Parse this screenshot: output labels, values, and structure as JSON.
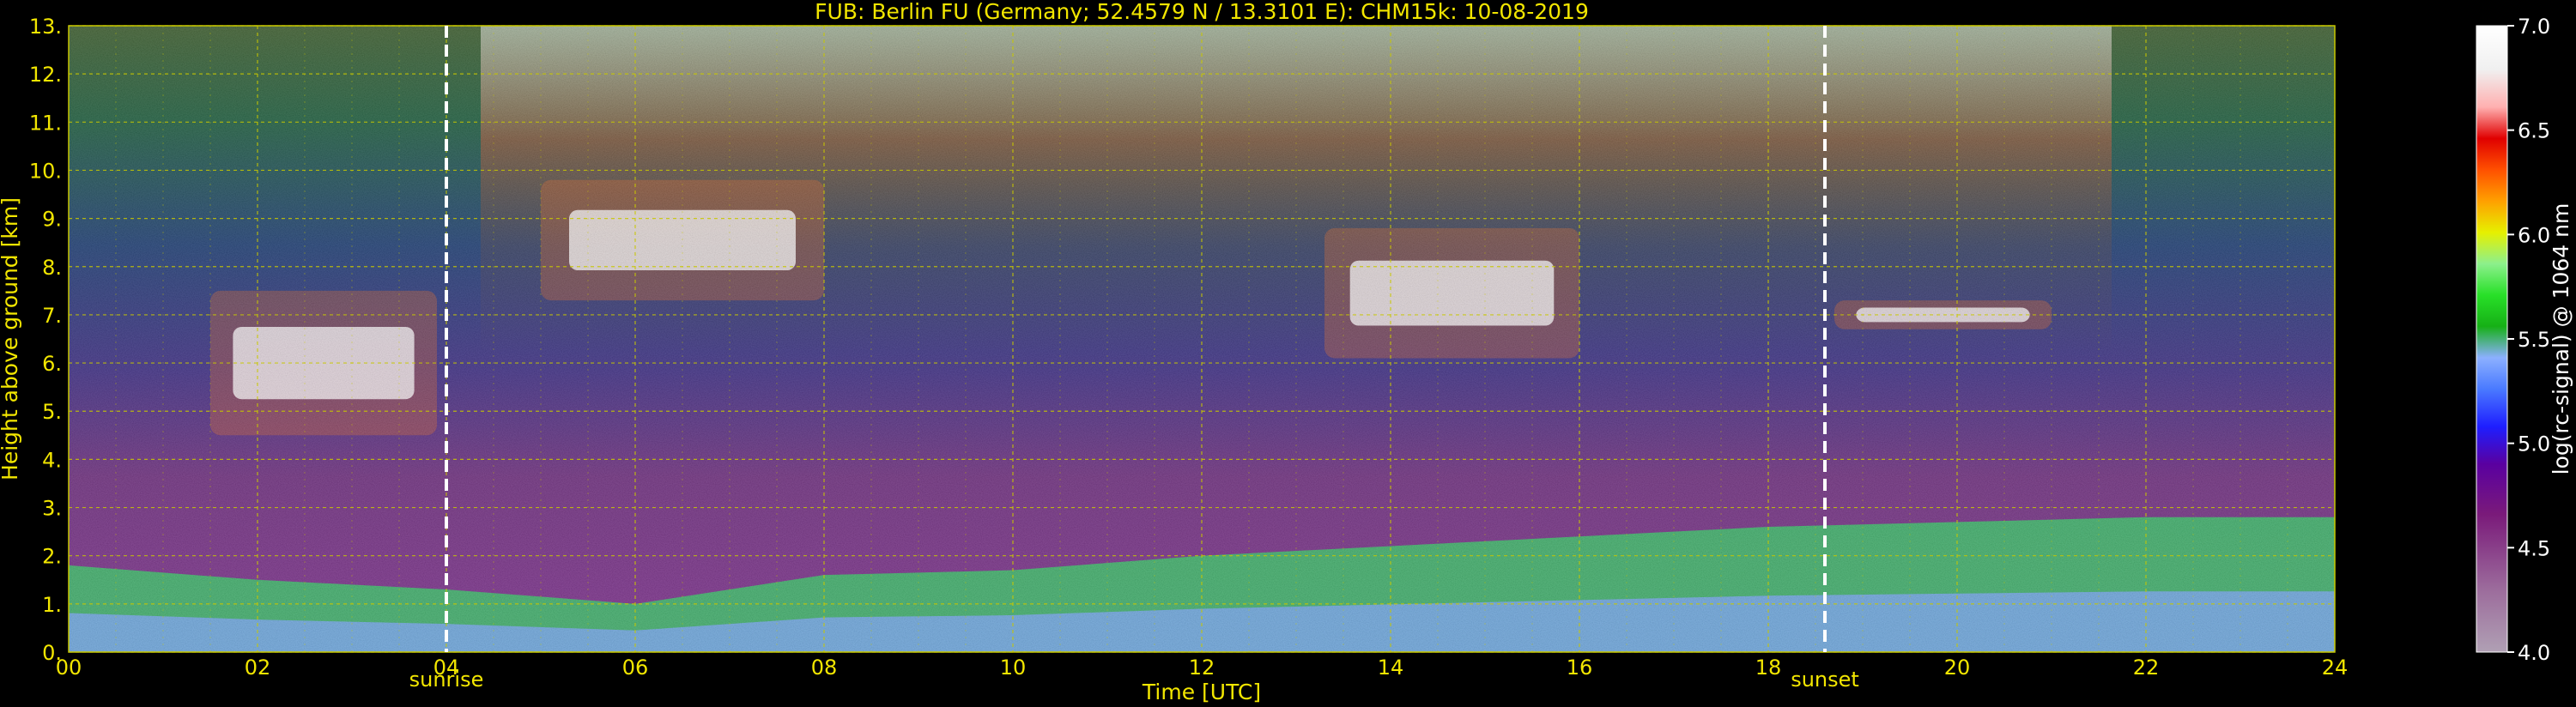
{
  "chart_data": {
    "type": "heatmap",
    "title": "FUB: Berlin FU (Germany; 52.4579 N / 13.3101 E):    CHM15k: 10-08-2019",
    "xlabel": "Time [UTC]",
    "ylabel": "Height above ground [km]",
    "colorbar_label": "log(rc-signal) @ 1064 nm",
    "xlim": [
      0,
      24
    ],
    "ylim": [
      0,
      13
    ],
    "x_ticks": [
      "00",
      "02",
      "04",
      "06",
      "08",
      "10",
      "12",
      "14",
      "16",
      "18",
      "20",
      "22",
      "24"
    ],
    "y_ticks": [
      "0.",
      "1.",
      "2.",
      "3.",
      "4.",
      "5.",
      "6.",
      "7.",
      "8.",
      "9.",
      "10.",
      "11.",
      "12.",
      "13."
    ],
    "colorbar_range": [
      4.0,
      7.0
    ],
    "colorbar_ticks": [
      "4.0",
      "4.5",
      "5.0",
      "5.5",
      "6.0",
      "6.5",
      "7.0"
    ],
    "grid": true,
    "annotations": [
      {
        "label": "sunrise",
        "time_utc": 4.0
      },
      {
        "label": "sunset",
        "time_utc": 18.6
      }
    ],
    "boundary_layer_height_km": [
      {
        "t": 0,
        "h": 1.8
      },
      {
        "t": 2,
        "h": 1.5
      },
      {
        "t": 4,
        "h": 1.3
      },
      {
        "t": 6,
        "h": 1.0
      },
      {
        "t": 8,
        "h": 1.6
      },
      {
        "t": 10,
        "h": 1.7
      },
      {
        "t": 12,
        "h": 2.0
      },
      {
        "t": 14,
        "h": 2.2
      },
      {
        "t": 16,
        "h": 2.4
      },
      {
        "t": 18,
        "h": 2.6
      },
      {
        "t": 20,
        "h": 2.7
      },
      {
        "t": 22,
        "h": 2.8
      },
      {
        "t": 24,
        "h": 2.8
      }
    ],
    "cloud_layers": [
      {
        "t_start": 1.5,
        "t_end": 3.9,
        "h_base": 4.5,
        "h_top": 7.5
      },
      {
        "t_start": 5.0,
        "t_end": 8.0,
        "h_base": 7.3,
        "h_top": 9.8
      },
      {
        "t_start": 13.3,
        "t_end": 16.0,
        "h_base": 6.1,
        "h_top": 8.8
      },
      {
        "t_start": 18.7,
        "t_end": 21.0,
        "h_base": 6.7,
        "h_top": 7.3
      }
    ],
    "colors": {
      "background": "#000000",
      "text": "#f2e600",
      "grid": "#c8c800",
      "colormap": [
        "#b0a0b4",
        "#9c6c9c",
        "#7a1a7a",
        "#5a00a0",
        "#1e1eff",
        "#4a7aff",
        "#8cb0ff",
        "#16b016",
        "#28e028",
        "#8cf08c",
        "#e6f000",
        "#ffa000",
        "#ff5000",
        "#e00000",
        "#ffb0b0",
        "#f0f0f0",
        "#ffffff"
      ]
    }
  }
}
